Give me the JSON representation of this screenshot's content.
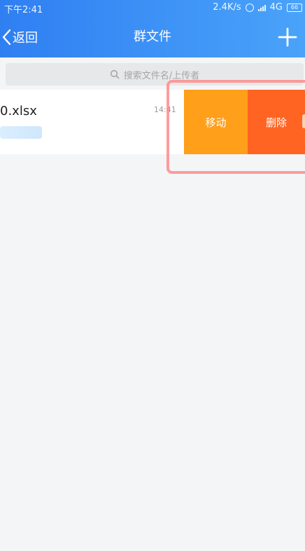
{
  "status_bar": {
    "time": "下午2:41",
    "network_speed": "2.4K/s",
    "network_type": "4G",
    "battery": "66"
  },
  "nav": {
    "back_label": "返回",
    "title": "群文件"
  },
  "search": {
    "placeholder": "搜索文件名/上传者"
  },
  "file": {
    "name": "0.xlsx",
    "time": "14:41"
  },
  "actions": {
    "move_label": "移动",
    "delete_label": "删除"
  },
  "colors": {
    "header_start": "#2f7ff2",
    "header_end": "#4aa3f9",
    "move_button": "#ff9f1a",
    "delete_button": "#ff6422",
    "highlight_border": "#ff8585"
  }
}
